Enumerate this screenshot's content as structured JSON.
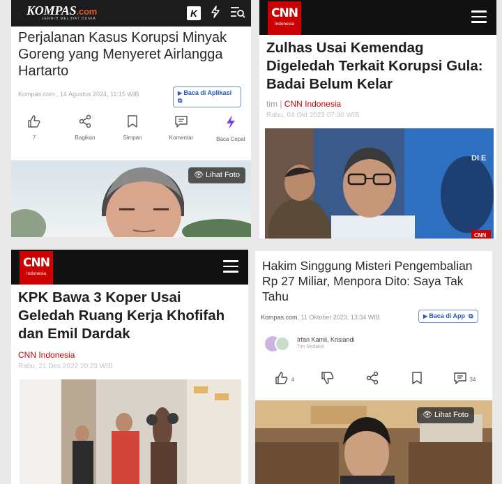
{
  "panel1": {
    "logo_main": "KOMPAS",
    "logo_suffix": ".com",
    "logo_tagline": "JERNIH MELIHAT DUNIA",
    "title": "Perjalanan Kasus Korupsi Minyak Goreng yang Menyeret Airlangga Hartarto",
    "meta": "Kompas.com , 14 Agustus 2024, 11:15 WIB",
    "app_button": "Baca di Aplikasi",
    "actions": [
      {
        "icon": "thumbs-up-icon",
        "label": "7"
      },
      {
        "icon": "share-icon",
        "label": "Bagikan"
      },
      {
        "icon": "bookmark-icon",
        "label": "Simpan"
      },
      {
        "icon": "comment-icon",
        "label": "Komentar"
      },
      {
        "icon": "lightning-icon",
        "label": "Baca Cepat"
      }
    ],
    "photo_button": "Lihat Foto"
  },
  "panel2": {
    "logo": "CNN",
    "logo_sub": "Indonesia",
    "title": "Zulhas Usai Kemendag Digeledah Terkait Korupsi Gula: Badai Belum Kelar",
    "source_prefix": "tim | ",
    "source": "CNN Indonesia",
    "date": "Rabu, 04 Okt 2023 07:30 WIB",
    "photo_text": "DI E",
    "photo_badge": "CNN"
  },
  "panel3": {
    "logo": "CNN",
    "logo_sub": "Indonesia",
    "title": "KPK Bawa 3 Koper Usai Geledah Ruang Kerja Khofifah dan Emil Dardak",
    "source": "CNN Indonesia",
    "date": "Rabu, 21 Des 2022 20:23 WIB"
  },
  "panel4": {
    "title": "Hakim Singgung Misteri Pengembalian Rp 27 Miliar, Menpora Dito: Saya Tak Tahu",
    "meta_site": "Kompas.com",
    "meta_date": ", 11 Oktober 2023, 13:34 WIB",
    "app_button": "Baca di App",
    "author": "Irfan Kamil, Krisiandi",
    "author_role": "Tim Redaksi",
    "actions": [
      {
        "icon": "thumbs-up-icon",
        "label": "4"
      },
      {
        "icon": "thumbs-down-icon",
        "label": ""
      },
      {
        "icon": "share-icon",
        "label": ""
      },
      {
        "icon": "bookmark-icon",
        "label": ""
      },
      {
        "icon": "comment-icon",
        "label": "34"
      }
    ],
    "photo_button": "Lihat Foto"
  },
  "colors": {
    "kompas_header": "#1c1c1c",
    "cnn_red": "#cc0000",
    "app_button_blue": "#2f55b5"
  }
}
